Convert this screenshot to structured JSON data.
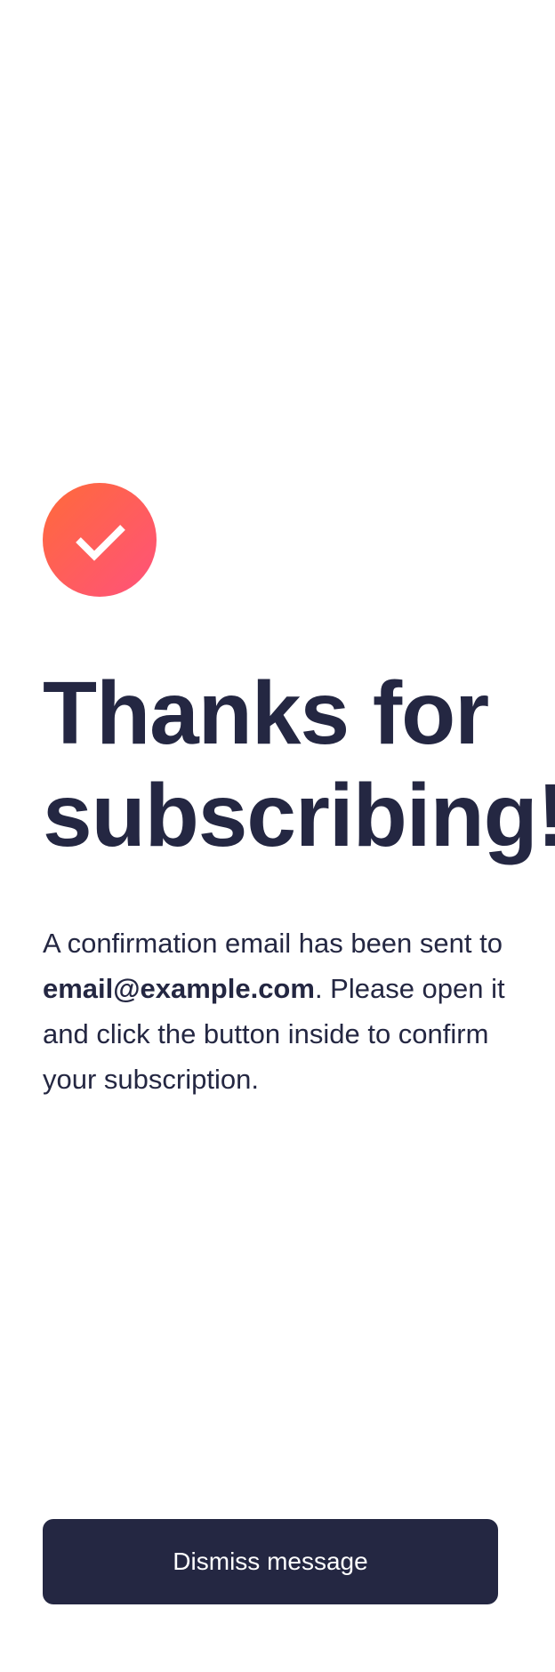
{
  "icon": {
    "name": "checkmark-icon",
    "gradient_start": "#ff6a3a",
    "gradient_end": "#ff527b"
  },
  "title": "Thanks for subscribing!",
  "message": {
    "prefix": "A confirmation email has been sent to ",
    "email": "email@example.com",
    "suffix": ". Please open it and click the button inside to confirm your subscription."
  },
  "dismiss_button": {
    "label": "Dismiss message"
  },
  "colors": {
    "text": "#242742",
    "button_bg": "#242742",
    "button_text": "#ffffff",
    "background": "#ffffff"
  }
}
